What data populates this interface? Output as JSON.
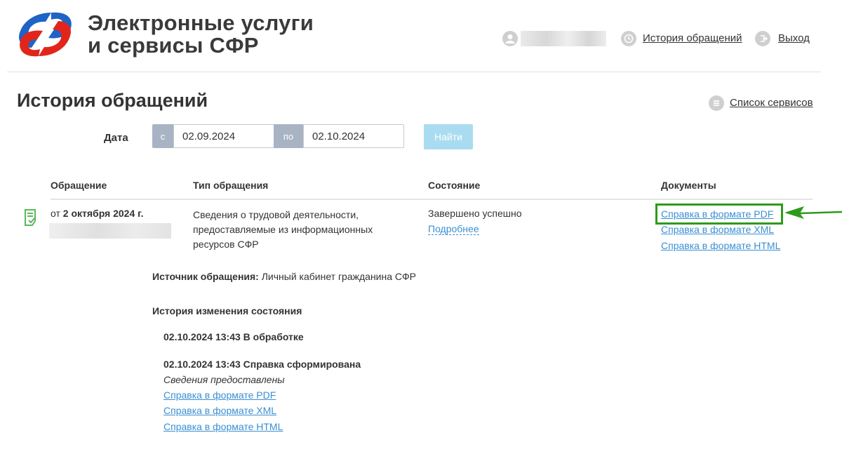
{
  "header": {
    "brand_line1": "Электронные услуги",
    "brand_line2": "и сервисы СФР",
    "history_link": "История обращений",
    "exit_link": "Выход"
  },
  "page": {
    "title": "История обращений",
    "services_link": "Список сервисов"
  },
  "filter": {
    "label": "Дата",
    "from_prefix": "с",
    "from_value": "02.09.2024",
    "to_prefix": "по",
    "to_value": "02.10.2024",
    "find_button": "Найти"
  },
  "table": {
    "columns": [
      "Обращение",
      "Тип обращения",
      "Состояние",
      "Документы"
    ],
    "row": {
      "date_prefix": "от ",
      "date_bold": "2 октября 2024 г.",
      "type": "Сведения о трудовой деятельности, предоставляемые из информационных ресурсов СФР",
      "status": "Завершено успешно",
      "more_link": "Подробнее",
      "documents": [
        "Справка в формате PDF",
        "Справка в формате XML",
        "Справка в формате HTML"
      ]
    }
  },
  "details": {
    "source_label": "Источник обращения:",
    "source_value": " Личный кабинет гражданина СФР",
    "history_title": "История изменения состояния",
    "events": [
      {
        "text": "02.10.2024 13:43 В обработке"
      },
      {
        "text": "02.10.2024 13:43 Справка сформирована",
        "note": "Сведения предоставлены",
        "links": [
          "Справка в формате PDF",
          "Справка в формате XML",
          "Справка в формате HTML"
        ]
      }
    ]
  },
  "colors": {
    "link": "#3a8fd3",
    "highlight": "#2e9a1c",
    "logo_blue": "#1f63c6",
    "logo_red": "#e1251b",
    "find_button_bg": "#a9dcf1"
  }
}
